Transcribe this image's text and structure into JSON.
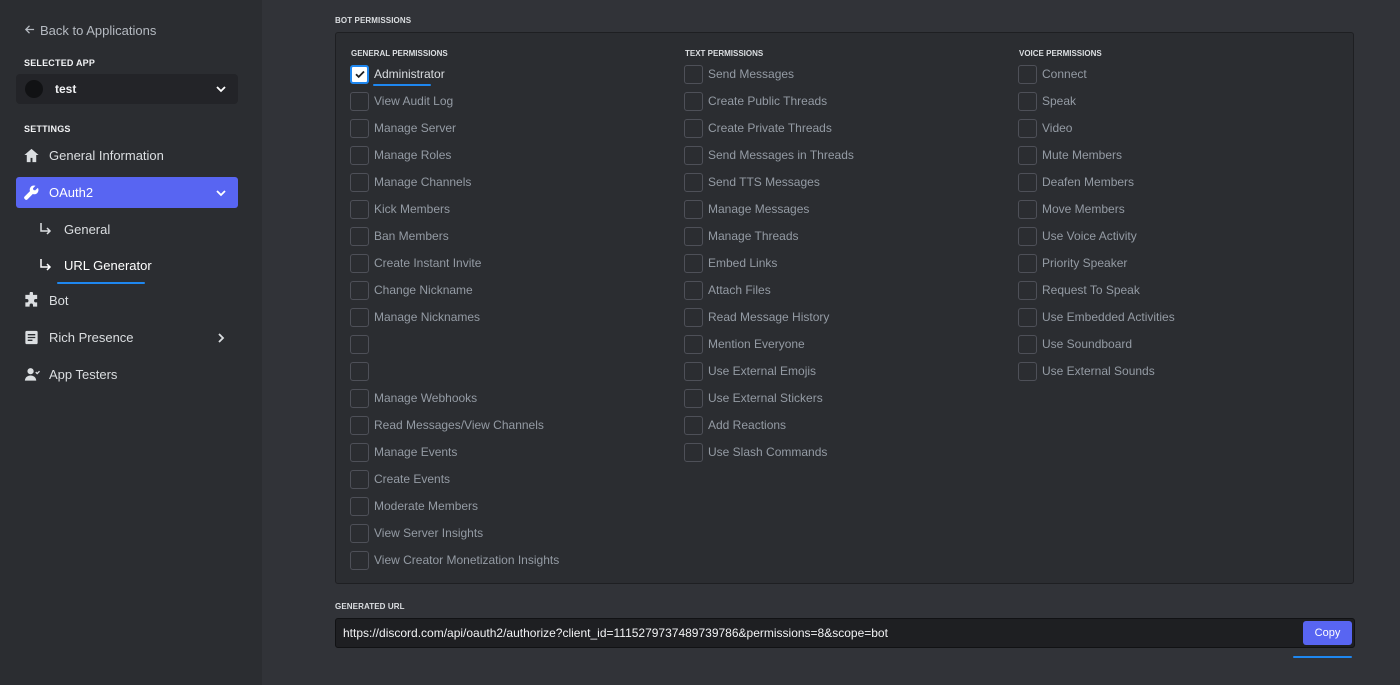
{
  "sidebar": {
    "back_label": "Back to Applications",
    "selected_app_heading": "SELECTED APP",
    "app_name": "test",
    "settings_heading": "SETTINGS",
    "items": {
      "general_information": "General Information",
      "oauth2": "OAuth2",
      "general": "General",
      "url_generator": "URL Generator",
      "bot": "Bot",
      "rich_presence": "Rich Presence",
      "app_testers": "App Testers"
    }
  },
  "main": {
    "bot_permissions_heading": "BOT PERMISSIONS",
    "columns": {
      "general": {
        "heading": "GENERAL PERMISSIONS",
        "items": [
          {
            "label": "Administrator",
            "checked": true
          },
          {
            "label": "View Audit Log",
            "checked": false
          },
          {
            "label": "Manage Server",
            "checked": false
          },
          {
            "label": "Manage Roles",
            "checked": false
          },
          {
            "label": "Manage Channels",
            "checked": false
          },
          {
            "label": "Kick Members",
            "checked": false
          },
          {
            "label": "Ban Members",
            "checked": false
          },
          {
            "label": "Create Instant Invite",
            "checked": false
          },
          {
            "label": "Change Nickname",
            "checked": false
          },
          {
            "label": "Manage Nicknames",
            "checked": false
          },
          {
            "label": "",
            "checked": false
          },
          {
            "label": "",
            "checked": false
          },
          {
            "label": "Manage Webhooks",
            "checked": false
          },
          {
            "label": "Read Messages/View Channels",
            "checked": false
          },
          {
            "label": "Manage Events",
            "checked": false
          },
          {
            "label": "Create Events",
            "checked": false
          },
          {
            "label": "Moderate Members",
            "checked": false
          },
          {
            "label": "View Server Insights",
            "checked": false
          },
          {
            "label": "View Creator Monetization Insights",
            "checked": false
          }
        ]
      },
      "text": {
        "heading": "TEXT PERMISSIONS",
        "items": [
          {
            "label": "Send Messages",
            "checked": false
          },
          {
            "label": "Create Public Threads",
            "checked": false
          },
          {
            "label": "Create Private Threads",
            "checked": false
          },
          {
            "label": "Send Messages in Threads",
            "checked": false
          },
          {
            "label": "Send TTS Messages",
            "checked": false
          },
          {
            "label": "Manage Messages",
            "checked": false
          },
          {
            "label": "Manage Threads",
            "checked": false
          },
          {
            "label": "Embed Links",
            "checked": false
          },
          {
            "label": "Attach Files",
            "checked": false
          },
          {
            "label": "Read Message History",
            "checked": false
          },
          {
            "label": "Mention Everyone",
            "checked": false
          },
          {
            "label": "Use External Emojis",
            "checked": false
          },
          {
            "label": "Use External Stickers",
            "checked": false
          },
          {
            "label": "Add Reactions",
            "checked": false
          },
          {
            "label": "Use Slash Commands",
            "checked": false
          }
        ]
      },
      "voice": {
        "heading": "VOICE PERMISSIONS",
        "items": [
          {
            "label": "Connect",
            "checked": false
          },
          {
            "label": "Speak",
            "checked": false
          },
          {
            "label": "Video",
            "checked": false
          },
          {
            "label": "Mute Members",
            "checked": false
          },
          {
            "label": "Deafen Members",
            "checked": false
          },
          {
            "label": "Move Members",
            "checked": false
          },
          {
            "label": "Use Voice Activity",
            "checked": false
          },
          {
            "label": "Priority Speaker",
            "checked": false
          },
          {
            "label": "Request To Speak",
            "checked": false
          },
          {
            "label": "Use Embedded Activities",
            "checked": false
          },
          {
            "label": "Use Soundboard",
            "checked": false
          },
          {
            "label": "Use External Sounds",
            "checked": false
          }
        ]
      }
    },
    "generated_url_heading": "GENERATED URL",
    "generated_url": "https://discord.com/api/oauth2/authorize?client_id=1115279737489739786&permissions=8&scope=bot",
    "copy_label": "Copy"
  },
  "colors": {
    "accent": "#5865f2",
    "annotation": "#1e87f0",
    "sidebar_bg": "#2b2d31",
    "main_bg": "#313338"
  },
  "icons": {
    "back": "arrow-left-icon",
    "app_dropdown": "chevron-down-icon",
    "general_information": "home-icon",
    "oauth2": "wrench-icon",
    "sub_items": "subdirectory-arrow-icon",
    "bot": "puzzle-icon",
    "rich_presence": "document-icon",
    "app_testers": "person-icon"
  }
}
